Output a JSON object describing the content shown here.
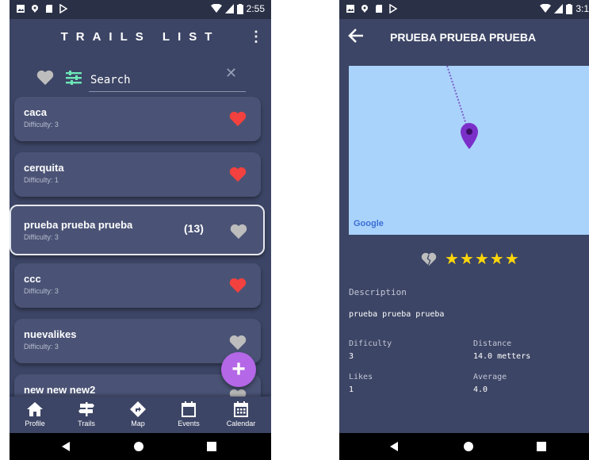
{
  "left_screen": {
    "status_time": "2:55",
    "title": "TRAILS LIST",
    "search": {
      "placeholder": "Search"
    },
    "trails": [
      {
        "name": "caca",
        "difficulty": "Difficulty: 3",
        "liked": true,
        "count": ""
      },
      {
        "name": "cerquita",
        "difficulty": "Difficulty: 1",
        "liked": true,
        "count": ""
      },
      {
        "name": "prueba prueba prueba",
        "difficulty": "Difficulty: 3",
        "liked": false,
        "count": "(13)"
      },
      {
        "name": "ccc",
        "difficulty": "Difficulty: 3",
        "liked": true,
        "count": ""
      },
      {
        "name": "nuevalikes",
        "difficulty": "Difficulty: 3",
        "liked": false,
        "count": ""
      },
      {
        "name": "new new new2",
        "difficulty": "",
        "liked": false,
        "count": ""
      }
    ],
    "fab_label": "+",
    "nav": [
      {
        "label": "Profile",
        "icon": "home-icon"
      },
      {
        "label": "Trails",
        "icon": "signpost-icon"
      },
      {
        "label": "Map",
        "icon": "directions-icon"
      },
      {
        "label": "Events",
        "icon": "calendar-icon"
      },
      {
        "label": "Calendar",
        "icon": "calendar-grid-icon"
      }
    ]
  },
  "right_screen": {
    "status_time": "3:1",
    "title": "PRUEBA PRUEBA PRUEBA",
    "map_attribution": "Google",
    "rating_stars": 5,
    "stars_text": "★★★★★",
    "description_label": "Description",
    "description": "prueba prueba prueba",
    "difficulty_label": "Dificulty",
    "difficulty_value": "3",
    "distance_label": "Distance",
    "distance_value": "14.0 metters",
    "likes_label": "Likes",
    "likes_value": "1",
    "average_label": "Average",
    "average_value": "4.0"
  },
  "colors": {
    "background": "#3c4565",
    "card": "#4a5375",
    "heart_liked": "#f2413e",
    "heart_unliked": "#bdbdbd",
    "fab": "#b467e6",
    "map_water": "#aad3fb",
    "marker": "#7b2fc9",
    "star": "#ffd60a",
    "filter_icon": "#6ee7b7"
  }
}
